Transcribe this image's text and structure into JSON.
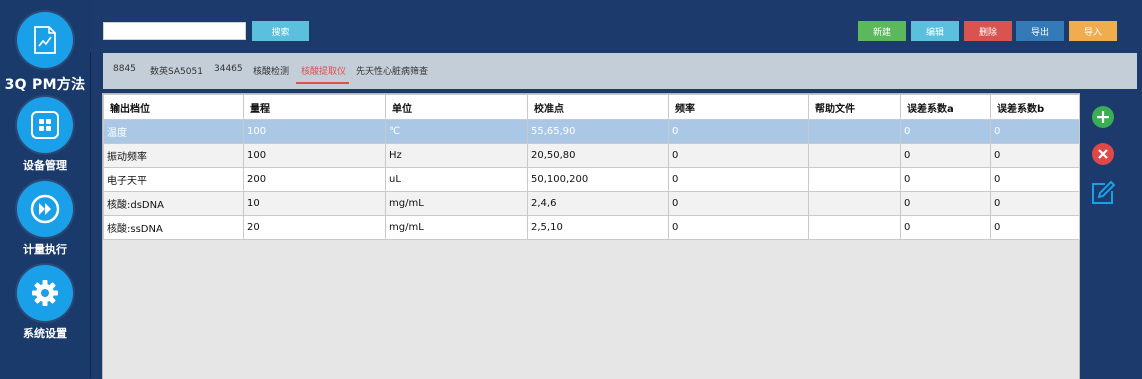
{
  "sidebar": {
    "brand": "3Q PM方法",
    "items": [
      {
        "label": "设备管理",
        "icon": "grid-icon"
      },
      {
        "label": "计量执行",
        "icon": "fast-forward-icon"
      },
      {
        "label": "系统设置",
        "icon": "gear-icon"
      }
    ]
  },
  "toolbar": {
    "search_value": "",
    "search_button": "搜索",
    "new": "新建",
    "edit": "编辑",
    "delete": "删除",
    "export": "导出",
    "import": "导入"
  },
  "tabs": [
    "8845",
    "数英SA5051",
    "34465",
    "核酸检测",
    "核酸提取仪",
    "先天性心脏病筛查"
  ],
  "active_tab": 4,
  "table": {
    "headers": [
      "输出档位",
      "量程",
      "单位",
      "校准点",
      "频率",
      "帮助文件",
      "误差系数a",
      "误差系数b"
    ],
    "rows": [
      [
        "温度",
        "100",
        "℃",
        "55,65,90",
        "0",
        "",
        "0",
        "0"
      ],
      [
        "振动频率",
        "100",
        "Hz",
        "20,50,80",
        "0",
        "",
        "0",
        "0"
      ],
      [
        "电子天平",
        "200",
        "uL",
        "50,100,200",
        "0",
        "",
        "0",
        "0"
      ],
      [
        "核酸:dsDNA",
        "10",
        "mg/mL",
        "2,4,6",
        "0",
        "",
        "0",
        "0"
      ],
      [
        "核酸:ssDNA",
        "20",
        "mg/mL",
        "2,5,10",
        "0",
        "",
        "0",
        "0"
      ]
    ],
    "selected_row": 0
  },
  "actions": {
    "add": "add-icon",
    "remove": "remove-icon",
    "edit": "edit-icon"
  },
  "colors": {
    "sidebar_bg": "#1a3a6c",
    "nav_circle": "#1aa0e8",
    "btn_search": "#5bc0de",
    "btn_new": "#5cb85c",
    "btn_edit": "#5bc0de",
    "btn_delete": "#d9534f",
    "btn_export": "#337ab7",
    "btn_import": "#f0ad4e",
    "active_tab": "#e05050",
    "selected_row": "#aac8e6"
  }
}
